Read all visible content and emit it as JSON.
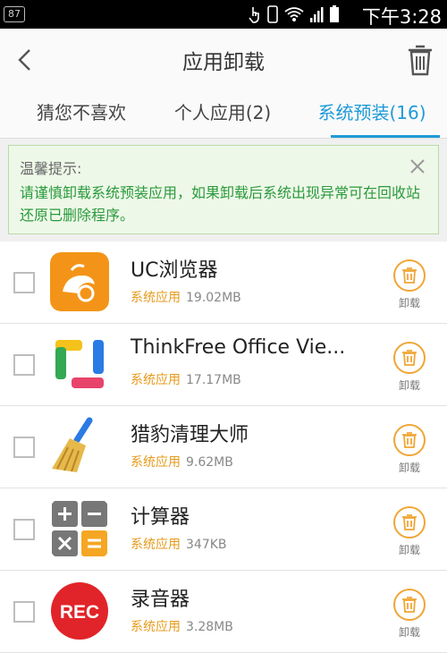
{
  "status_bar": {
    "badge": "87",
    "time": "下午3:28",
    "icons": [
      "touch-icon",
      "phone-icon",
      "wifi-icon",
      "signal-icon",
      "battery-icon"
    ]
  },
  "header": {
    "title": "应用卸载",
    "back_icon": "back-arrow-icon",
    "trash_icon": "trash-icon"
  },
  "tabs": [
    {
      "label": "猜您不喜欢",
      "active": false
    },
    {
      "label": "个人应用(2)",
      "active": false
    },
    {
      "label": "系统预装(16)",
      "active": true
    }
  ],
  "notice": {
    "title": "温馨提示:",
    "body": "请谨慎卸载系统预装应用，如果卸载后系统出现异常可在回收站还原已删除程序。"
  },
  "apps": [
    {
      "name": "UC浏览器",
      "type": "系统应用",
      "size": "19.02MB",
      "icon": "uc-browser-icon",
      "uninstall_label": "卸载"
    },
    {
      "name": "ThinkFree Office Vie...",
      "type": "系统应用",
      "size": "17.17MB",
      "icon": "thinkfree-office-icon",
      "uninstall_label": "卸载"
    },
    {
      "name": "猎豹清理大师",
      "type": "系统应用",
      "size": "9.62MB",
      "icon": "clean-master-broom-icon",
      "uninstall_label": "卸载"
    },
    {
      "name": "计算器",
      "type": "系统应用",
      "size": "347KB",
      "icon": "calculator-icon",
      "uninstall_label": "卸载"
    },
    {
      "name": "录音器",
      "type": "系统应用",
      "size": "3.28MB",
      "icon": "rec-recorder-icon",
      "icon_text": "REC",
      "uninstall_label": "卸载"
    }
  ],
  "colors": {
    "accent": "#1e9bd8",
    "notice_green": "#2a9a3c",
    "orange": "#f0a636"
  }
}
